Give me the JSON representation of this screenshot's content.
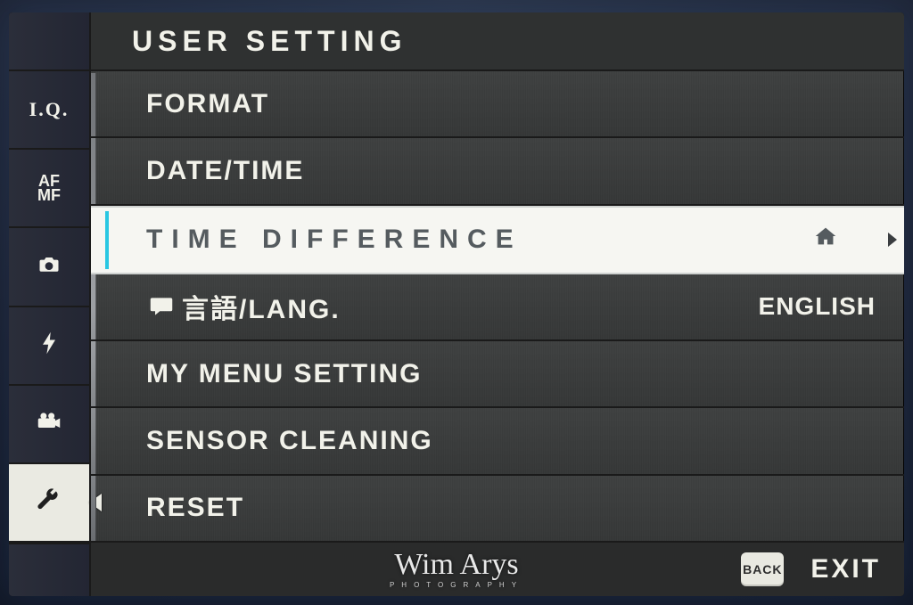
{
  "header": {
    "title": "USER SETTING"
  },
  "sidebar": {
    "items": [
      {
        "id": "iq",
        "label": "I.Q."
      },
      {
        "id": "afmf",
        "label": "AF\nMF"
      },
      {
        "id": "camera",
        "label": "camera-icon"
      },
      {
        "id": "flash",
        "label": "flash-icon"
      },
      {
        "id": "movie",
        "label": "movie-icon"
      },
      {
        "id": "wrench",
        "label": "wrench-icon"
      }
    ],
    "selected_id": "wrench"
  },
  "menu": {
    "items": [
      {
        "label": "FORMAT"
      },
      {
        "label": "DATE/TIME"
      },
      {
        "label": "TIME DIFFERENCE",
        "value_icon": "home",
        "selected": true
      },
      {
        "label": "言語/LANG.",
        "prefix_icon": "speech",
        "value": "ENGLISH"
      },
      {
        "label": "MY MENU SETTING"
      },
      {
        "label": "SENSOR CLEANING"
      },
      {
        "label": "RESET"
      }
    ]
  },
  "footer": {
    "back_label": "BACK",
    "exit_label": "EXIT"
  },
  "watermark": {
    "name": "Wim Arys",
    "sub": "PHOTOGRAPHY"
  }
}
